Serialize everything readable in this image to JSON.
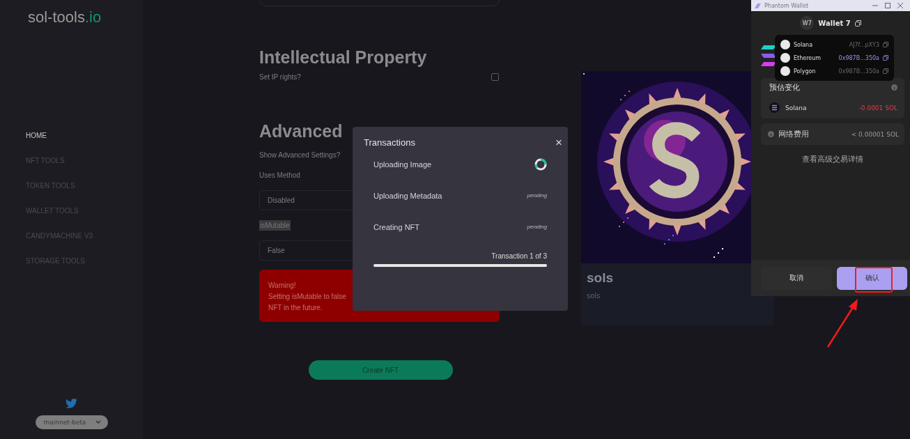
{
  "sidebar": {
    "logo": {
      "name": "sol-tools",
      "suffix": ".io"
    },
    "items": [
      {
        "label": "HOME",
        "selected": true
      },
      {
        "label": "NFT TOOLS",
        "selected": false
      },
      {
        "label": "TOKEN TOOLS",
        "selected": false
      },
      {
        "label": "WALLET TOOLS",
        "selected": false
      },
      {
        "label": "CANDYMACHINE V3",
        "selected": false
      },
      {
        "label": "STORAGE TOOLS",
        "selected": false
      }
    ],
    "network": "mainnet-beta"
  },
  "form": {
    "ip_heading": "Intellectual Property",
    "ip_label": "Set IP rights?",
    "ip_checked": false,
    "advanced_heading": "Advanced",
    "advanced_label": "Show Advanced Settings?",
    "uses_label": "Uses Method",
    "uses_value": "Disabled",
    "mutable_label": "isMutable",
    "mutable_value": "False",
    "warning": [
      "Warning!",
      "Setting isMutable to false",
      "NFT in the future."
    ],
    "create_button": "Create NFT"
  },
  "preview": {
    "kind": "picture",
    "title": "sols",
    "description": "sols"
  },
  "modal": {
    "title": "Transactions",
    "close": "×",
    "steps": [
      {
        "label": "Uploading Image",
        "kind": "spinner"
      },
      {
        "label": "Uploading Metadata",
        "kind": "pending",
        "status": "pending"
      },
      {
        "label": "Creating NFT",
        "kind": "pending",
        "status": "pending"
      }
    ],
    "progress_text": "Transaction 1 of 3",
    "level": 1
  },
  "wallet": {
    "window_title": "Phantom Wallet",
    "avatar": "W7",
    "account": "Wallet 7",
    "chains": [
      {
        "name": "Solana",
        "address": "AJ7f...pXY3",
        "selected": false
      },
      {
        "name": "Ethereum",
        "address": "0x987B...350a",
        "selected": true
      },
      {
        "name": "Polygon",
        "address": "0x987B...350a",
        "selected": false
      }
    ],
    "changes_title": "预估变化",
    "change_token": "Solana",
    "change_amount": "-0.0001 SOL",
    "fee_label": "网络费用",
    "fee_value": "< 0.00001 SOL",
    "details_link": "查看高级交易详情",
    "cancel": "取消",
    "confirm": "确认"
  }
}
